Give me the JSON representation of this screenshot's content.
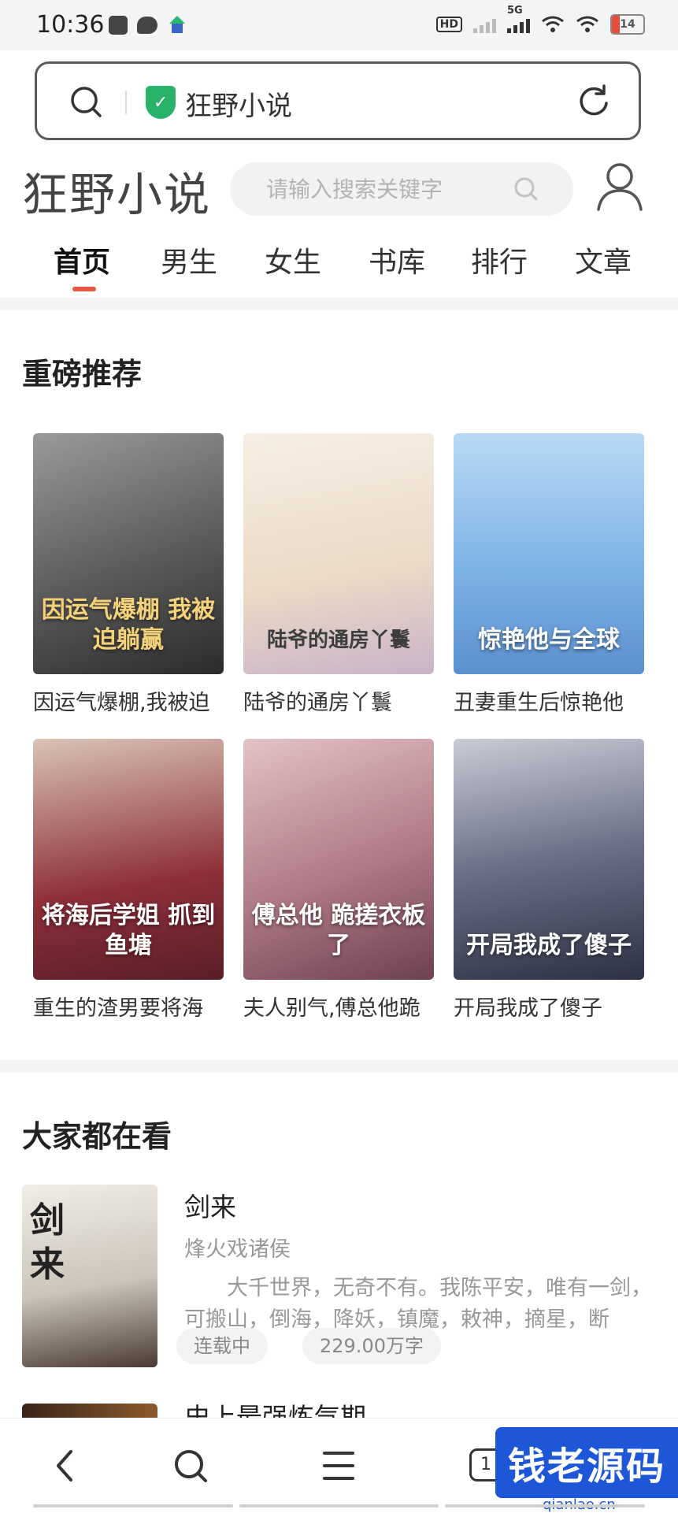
{
  "status_bar": {
    "time": "10:36",
    "network_type": "5G",
    "hd_label": "HD",
    "battery": "14"
  },
  "browser": {
    "page_title": "狂野小说",
    "icons": [
      "search-icon",
      "secure-shield-icon",
      "refresh-icon"
    ]
  },
  "site": {
    "logo": "狂野小说",
    "search_placeholder": "请输入搜索关键字",
    "accent_color": "#e5573f"
  },
  "tabs": [
    {
      "label": "首页",
      "active": true
    },
    {
      "label": "男生",
      "active": false
    },
    {
      "label": "女生",
      "active": false
    },
    {
      "label": "书库",
      "active": false
    },
    {
      "label": "排行",
      "active": false
    },
    {
      "label": "文章",
      "active": false
    }
  ],
  "recommend": {
    "title": "重磅推荐",
    "books": [
      {
        "title": "因运气爆棚,我被迫",
        "cover_text": "因运气爆棚 我被迫躺赢",
        "cover_color": "#6b6b6b"
      },
      {
        "title": "陆爷的通房丫鬟",
        "cover_text": "陆爷的通房丫鬟",
        "cover_color": "#efe6da"
      },
      {
        "title": "丑妻重生后惊艳他",
        "cover_text": "惊艳他与全球",
        "cover_color": "#7fb4e6"
      },
      {
        "title": "重生的渣男要将海",
        "cover_text": "将海后学姐 抓到鱼塘",
        "cover_color": "#8e2f3a"
      },
      {
        "title": "夫人别气,傅总他跪",
        "cover_text": "傅总他 跪搓衣板了",
        "cover_color": "#b07a86"
      },
      {
        "title": "开局我成了傻子",
        "cover_text": "开局我成了傻子",
        "cover_color": "#3b3f56"
      }
    ]
  },
  "popular": {
    "title": "大家都在看",
    "items": [
      {
        "name": "剑来",
        "author": "烽火戏诸侯",
        "description": "大千世界，无奇不有。我陈平安，唯有一剑，可搬山，倒海，降妖，镇魔，敕神，摘星，断江，…",
        "status": "连载中",
        "word_count": "229.00万字",
        "cover_text": "剑来"
      }
    ],
    "next_item_peek": "史上最强炼气期"
  },
  "bottom_nav": {
    "tab_count": "1"
  },
  "watermark": {
    "brand": "钱老源码",
    "url": "qianlao.cn"
  }
}
